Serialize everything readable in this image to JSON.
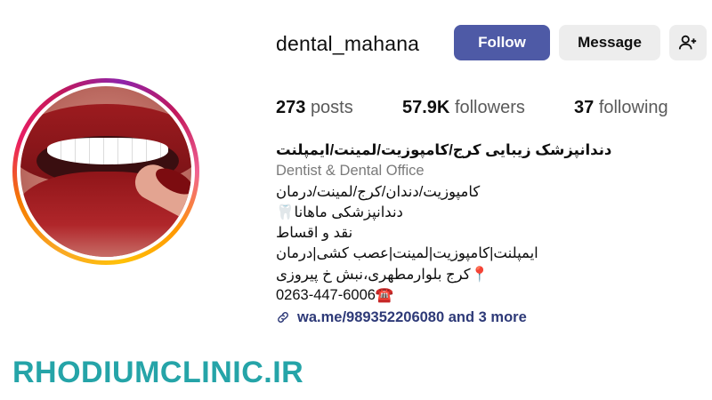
{
  "profile": {
    "username": "dental_mahana",
    "follow_label": "Follow",
    "message_label": "Message",
    "add_user_icon": "person-add-icon",
    "stats": {
      "posts_count": "273",
      "posts_label": "posts",
      "followers_count": "57.9K",
      "followers_label": "followers",
      "following_count": "37",
      "following_label": "following"
    }
  },
  "bio": {
    "name": "دندانپزشک زیبایی کرج/کامپوزیت/لمینت/ایمپلنت",
    "category": "Dentist & Dental Office",
    "lines": [
      "کامپوزیت/دندان/کرج/لمینت/درمان",
      "دندانپزشکی ماهانا🦷",
      "نقد و اقساط",
      "ایمپلنت|کامپوزیت|لمینت|عصب کشی|درمان",
      "📍کرج بلوارمطهری،نبش خ پیروزی",
      "0263-447-6006☎️"
    ],
    "link_text": "wa.me/989352206080 and 3 more"
  },
  "watermark": "RHODIUMCLINIC.IR",
  "colors": {
    "follow_button": "#4e5aa6",
    "secondary_button": "#ededed",
    "link": "#2e3a78",
    "watermark": "#25a4a8"
  }
}
